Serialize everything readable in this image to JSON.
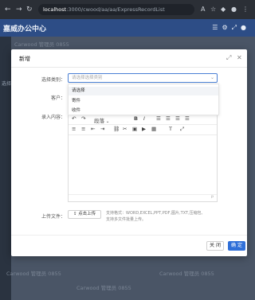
{
  "browser": {
    "back_icon": "back-arrow-icon",
    "reload_icon": "reload-icon",
    "url_host": "localhost",
    "url_path": ":3000/cwood/aa/aa/ExpressRecordList"
  },
  "app": {
    "title": "嘉威办公中心"
  },
  "background": {
    "faded_label": "选择类",
    "watermark": "Carwood 管理员 0855"
  },
  "dialog": {
    "title": "新增",
    "fields": {
      "category_label": "选择类别：",
      "category_placeholder": "请选择选择类别",
      "customer_label": "客户：",
      "content_label": "录入内容：",
      "upload_label": "上传文件："
    },
    "dropdown_options": [
      "请选择",
      "寄件",
      "收件"
    ],
    "editor": {
      "paragraph_label": "段落",
      "status_p": "p"
    },
    "upload_button_label": "点击上传",
    "upload_hint_line1": "支持格式：WORD,EXCEL,PPT,PDF,图片,TXT,压缩包,",
    "upload_hint_line2": "支持多文件批量上传。",
    "cancel_label": "关 闭",
    "ok_label": "确 定"
  }
}
